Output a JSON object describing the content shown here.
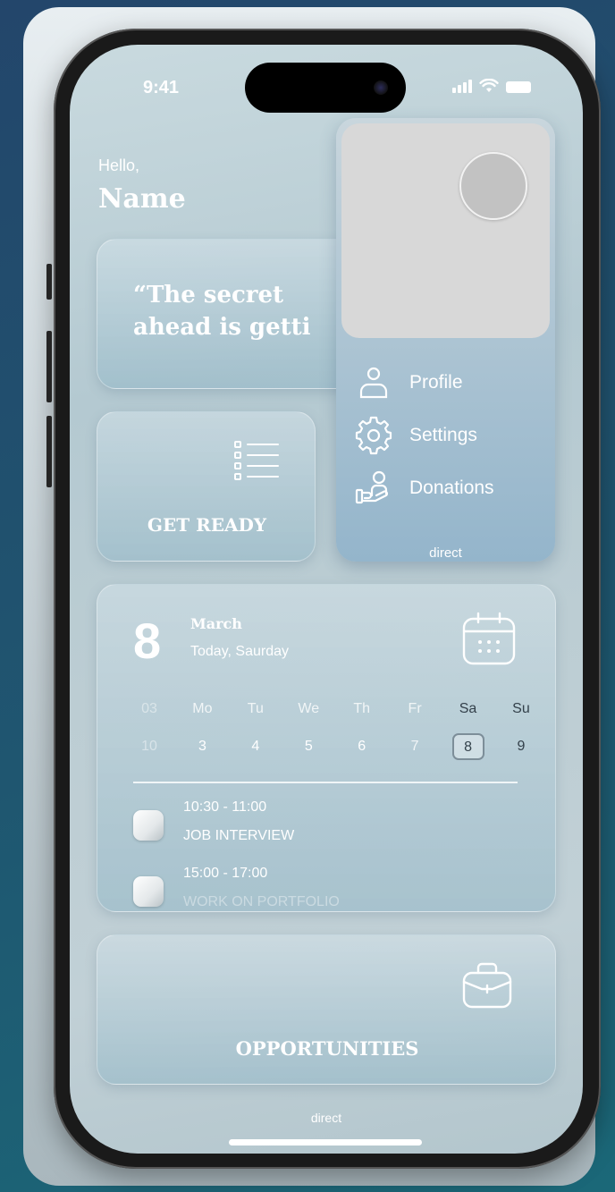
{
  "status_bar": {
    "time": "9:41"
  },
  "greeting": {
    "hello": "Hello,",
    "name": "Name"
  },
  "quote": {
    "line1": "“The secret",
    "line2": "ahead is getti"
  },
  "get_ready": {
    "label": "GET READY",
    "icon": "checklist-icon"
  },
  "profile_menu": {
    "items": [
      {
        "label": "Profile",
        "icon": "user-icon"
      },
      {
        "label": "Settings",
        "icon": "gear-icon"
      },
      {
        "label": "Donations",
        "icon": "hand-heart-icon"
      }
    ],
    "footer": "direct"
  },
  "calendar": {
    "day_number": "8",
    "month": "March",
    "subtitle": "Today, Saurday",
    "icon": "calendar-icon",
    "header_row": [
      "03",
      "Mo",
      "Tu",
      "We",
      "Th",
      "Fr",
      "Sa",
      "Su"
    ],
    "date_row": [
      "10",
      "3",
      "4",
      "5",
      "6",
      "7",
      "8",
      "9"
    ],
    "selected_day": "8",
    "events": [
      {
        "time": "10:30 - 11:00",
        "title": "JOB INTERVIEW"
      },
      {
        "time": "15:00 - 17:00",
        "title": "WORK ON PORTFOLIO"
      }
    ]
  },
  "opportunities": {
    "label": "OPPORTUNITIES",
    "icon": "briefcase-icon"
  },
  "footer": {
    "direct": "direct"
  }
}
